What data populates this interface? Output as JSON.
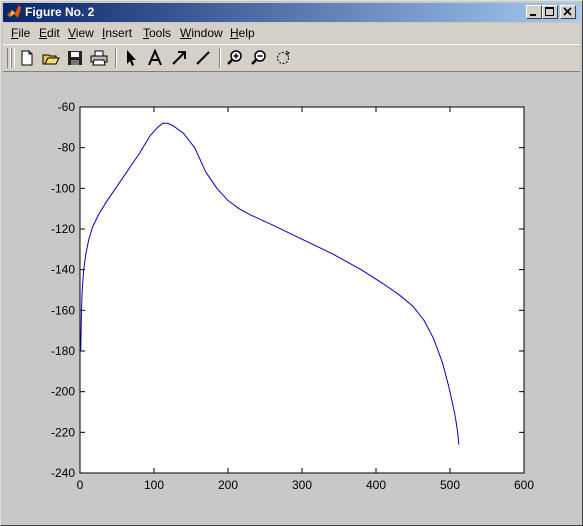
{
  "window": {
    "title": "Figure No. 2",
    "controls": [
      "minimize",
      "maximize",
      "close"
    ]
  },
  "menubar": {
    "items": [
      {
        "label": "File",
        "accel": "F"
      },
      {
        "label": "Edit",
        "accel": "E"
      },
      {
        "label": "View",
        "accel": "V"
      },
      {
        "label": "Insert",
        "accel": "I"
      },
      {
        "label": "Tools",
        "accel": "T"
      },
      {
        "label": "Window",
        "accel": "W"
      },
      {
        "label": "Help",
        "accel": "H"
      }
    ]
  },
  "toolbar": {
    "buttons": [
      "new-figure-icon",
      "open-file-icon",
      "save-icon",
      "print-icon",
      "edit-plot-arrow-icon",
      "insert-text-icon",
      "insert-arrow-icon",
      "insert-line-icon",
      "zoom-in-icon",
      "zoom-out-icon",
      "rotate-3d-icon"
    ]
  },
  "colors": {
    "line": "#0000c8",
    "figure_bg": "#c8c8c8",
    "axes_bg": "#ffffff"
  },
  "chart_data": {
    "type": "line",
    "title": "",
    "xlabel": "",
    "ylabel": "",
    "xlim": [
      0,
      600
    ],
    "ylim": [
      -240,
      -60
    ],
    "xticks": [
      0,
      100,
      200,
      300,
      400,
      500,
      600
    ],
    "yticks": [
      -60,
      -80,
      -100,
      -120,
      -140,
      -160,
      -180,
      -200,
      -220,
      -240
    ],
    "grid": false,
    "series": [
      {
        "values_x": [
          1,
          2,
          3,
          5,
          8,
          12,
          17,
          25,
          35,
          50,
          65,
          80,
          95,
          105,
          112,
          118,
          125,
          140,
          155,
          170,
          185,
          200,
          215,
          230,
          260,
          300,
          340,
          380,
          410,
          430,
          450,
          465,
          478,
          490,
          498,
          503,
          507,
          510,
          511.5,
          512
        ],
        "values_y": [
          -180,
          -160,
          -150,
          -140,
          -132,
          -125,
          -119,
          -113,
          -107,
          -99,
          -91,
          -83,
          -74,
          -70,
          -68,
          -68,
          -69,
          -73,
          -80,
          -92,
          -100,
          -106,
          -110,
          -113,
          -118,
          -125,
          -132,
          -140,
          -147,
          -152,
          -158,
          -165,
          -174,
          -186,
          -197,
          -205,
          -212,
          -219,
          -224,
          -226
        ]
      }
    ]
  }
}
